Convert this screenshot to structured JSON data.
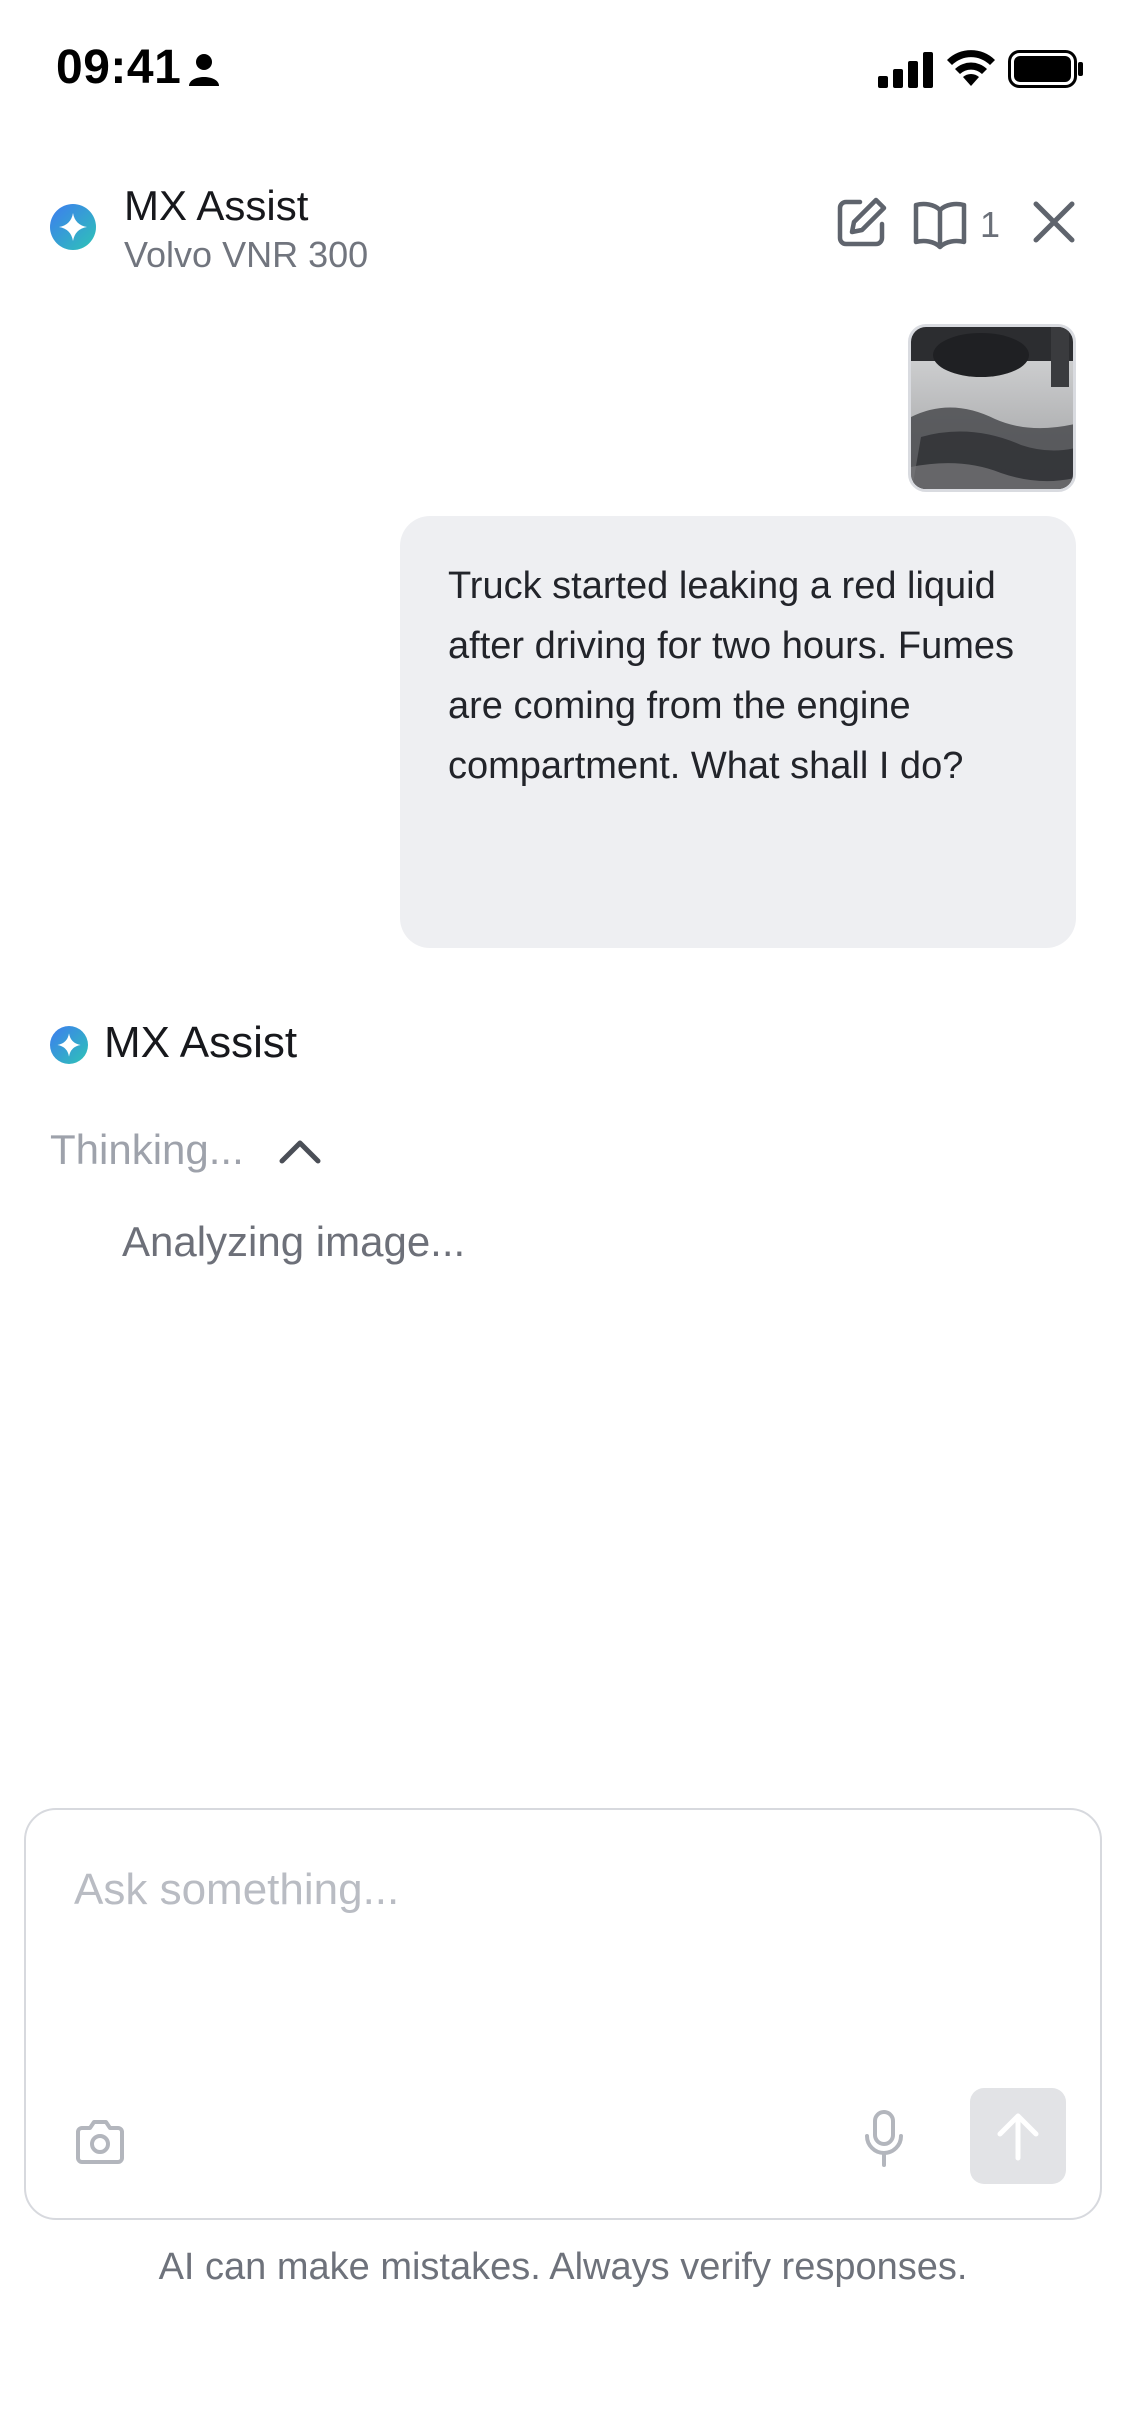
{
  "status_bar": {
    "time": "09:41",
    "icons": [
      "person-icon",
      "cellular-signal-icon",
      "wifi-icon",
      "battery-icon"
    ]
  },
  "header": {
    "title": "MX Assist",
    "subtitle": "Volvo VNR 300",
    "icons": [
      "sparkle-icon",
      "edit-icon",
      "book-icon",
      "close-icon"
    ],
    "book_count": "1"
  },
  "conversation": {
    "user_message": {
      "attachment_icon": "photo-thumbnail",
      "text": "Truck started leaking a red liquid after driving for two hours. Fumes are coming from the engine compartment. What shall I do?"
    },
    "assistant": {
      "name": "MX Assist",
      "thinking_label": "Thinking...",
      "thinking_icon": "chevron-up-icon",
      "thinking_detail": "Analyzing image..."
    }
  },
  "composer": {
    "placeholder": "Ask something...",
    "value": "",
    "icons": [
      "camera-icon",
      "microphone-icon",
      "arrow-up-icon"
    ]
  },
  "disclaimer": "AI can make mistakes. Always verify responses.",
  "colors": {
    "accent_blue": "#3d7cf0",
    "accent_teal": "#2ec4b6",
    "bubble_bg": "#eeeff2",
    "muted_text": "#9ea2ab"
  }
}
